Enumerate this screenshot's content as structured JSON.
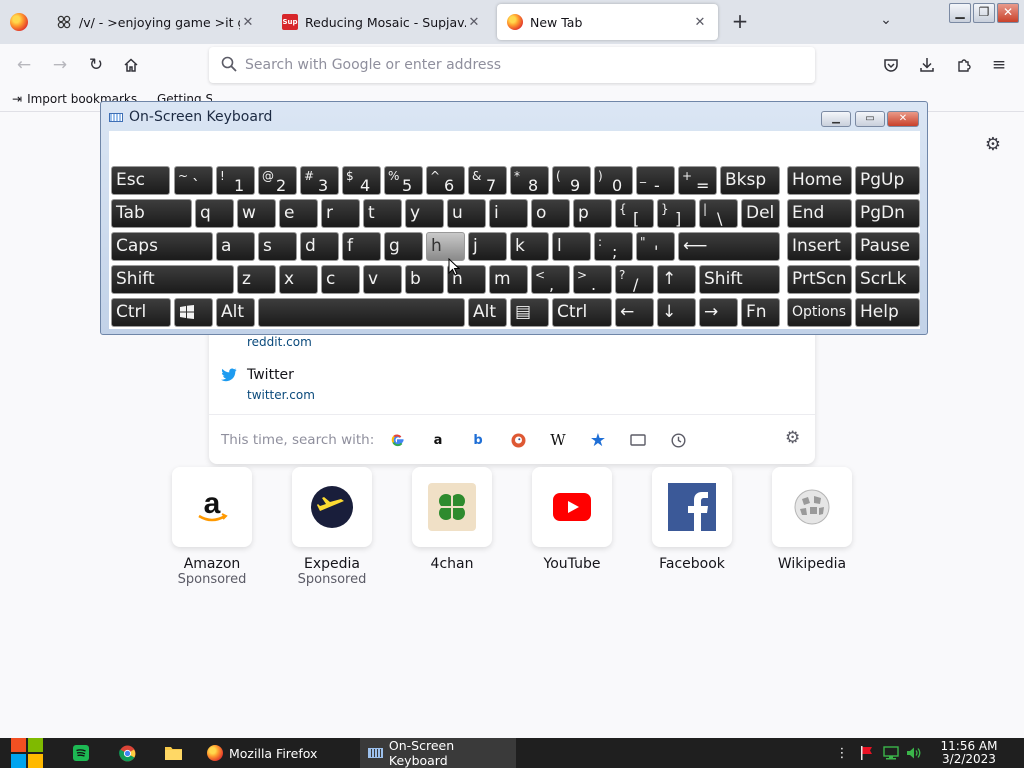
{
  "tabs": [
    {
      "title": "/v/ - >enjoying game >it gets a",
      "close": "✕"
    },
    {
      "title": "Reducing Mosaic - Supjav.com",
      "favicon_text": "Sup",
      "close": "✕"
    },
    {
      "title": "New Tab",
      "close": "✕"
    }
  ],
  "toolbar": {
    "newtab": "+",
    "tablist": "⌄",
    "search_placeholder": "Search with Google or enter address"
  },
  "bookmarks": {
    "import": "Import bookmarks...",
    "getting_started": "Getting Started"
  },
  "suggestions": [
    {
      "title": "",
      "url": "reddit.com"
    },
    {
      "title": "Twitter",
      "url": "twitter.com"
    }
  ],
  "search_engines": {
    "label": "This time, search with:",
    "items": [
      "google-icon",
      "amazon-icon",
      "bing-icon",
      "duckduckgo-icon",
      "wikipedia-icon",
      "bookmarks-icon",
      "tabs-icon",
      "history-icon"
    ]
  },
  "top_sites": [
    {
      "name": "Amazon",
      "sponsored": "Sponsored"
    },
    {
      "name": "Expedia",
      "sponsored": "Sponsored"
    },
    {
      "name": "4chan",
      "sponsored": ""
    },
    {
      "name": "YouTube",
      "sponsored": ""
    },
    {
      "name": "Facebook",
      "sponsored": ""
    },
    {
      "name": "Wikipedia",
      "sponsored": ""
    }
  ],
  "osk": {
    "title": "On-Screen Keyboard",
    "keys": {
      "esc": "Esc",
      "bksp": "Bksp",
      "home": "Home",
      "pgup": "PgUp",
      "tab": "Tab",
      "del": "Del",
      "end": "End",
      "pgdn": "PgDn",
      "caps": "Caps",
      "enter": "⟵",
      "insert": "Insert",
      "pause": "Pause",
      "shift_l": "Shift",
      "shift_r": "Shift",
      "up": "↑",
      "prtscn": "PrtScn",
      "scrlk": "ScrLk",
      "ctrl_l": "Ctrl",
      "alt_l": "Alt",
      "alt_r": "Alt",
      "menu": "▤",
      "ctrl_r": "Ctrl",
      "left": "←",
      "down": "↓",
      "right": "→",
      "fn": "Fn",
      "options": "Options",
      "help": "Help",
      "q": "q",
      "w": "w",
      "e": "e",
      "r": "r",
      "t": "t",
      "y": "y",
      "u": "u",
      "i": "i",
      "o": "o",
      "p": "p",
      "a": "a",
      "s": "s",
      "d": "d",
      "f": "f",
      "g": "g",
      "h": "h",
      "j": "j",
      "k": "k",
      "l": "l",
      "z": "z",
      "x": "x",
      "c": "c",
      "v": "v",
      "b": "b",
      "n": "n",
      "m": "m",
      "num": [
        [
          "~",
          "`"
        ],
        [
          "!",
          "1"
        ],
        [
          "@",
          "2"
        ],
        [
          "#",
          "3"
        ],
        [
          "$",
          "4"
        ],
        [
          "%",
          "5"
        ],
        [
          "^",
          "6"
        ],
        [
          "&",
          "7"
        ],
        [
          "*",
          "8"
        ],
        [
          "(",
          "9"
        ],
        [
          ")",
          "0"
        ],
        [
          "_",
          "-"
        ],
        [
          "+",
          "="
        ]
      ],
      "brackets": [
        [
          "{",
          "["
        ],
        [
          "}",
          "]"
        ],
        [
          "|",
          "\\"
        ]
      ],
      "punct_home": [
        [
          ":",
          ";"
        ],
        [
          "\"",
          "'"
        ]
      ],
      "punct_bottom": [
        [
          "<",
          ","
        ],
        [
          ">",
          "."
        ],
        [
          "?",
          "/"
        ]
      ]
    }
  },
  "taskbar": {
    "tasks": [
      "Mozilla Firefox",
      "On-Screen Keyboard"
    ],
    "time": "11:56 AM",
    "date": "3/2/2023"
  }
}
